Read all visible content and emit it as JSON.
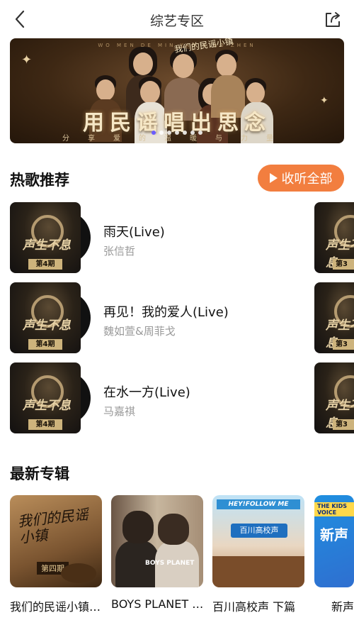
{
  "header": {
    "title": "综艺专区",
    "back_icon": "chevron-left-icon",
    "share_icon": "share-icon"
  },
  "banner": {
    "top_text": "WO MEN DE MIN YAO XIAO ZHEN",
    "logo_text": "我们的民谣小镇",
    "slogan": "用民谣唱出思念",
    "subtitle": "分享爱的温暖与力量",
    "dots_count": 7,
    "active_dot": 0
  },
  "hot_songs": {
    "section_title": "热歌推荐",
    "listen_all_label": "收听全部",
    "play_icon": "play-icon",
    "cover_episode": "第4期",
    "side_episode": "第3",
    "cover_logo": "声生不息",
    "items": [
      {
        "name": "雨天(Live)",
        "artist": "张信哲"
      },
      {
        "name": "再见！我的爱人(Live)",
        "artist": "魏如萱&周菲戈"
      },
      {
        "name": "在水一方(Live)",
        "artist": "马嘉祺"
      }
    ]
  },
  "new_albums": {
    "section_title": "最新专辑",
    "items": [
      {
        "title": "我们的民谣小镇…",
        "cover_text": "我们的民谣小镇",
        "cover_badge": "第四期"
      },
      {
        "title": "BOYS PLANET …",
        "cover_text": "BOYS PLANET"
      },
      {
        "title": "百川高校声 下篇",
        "cover_text": "百川高校声",
        "cover_header": "HEY!FOLLOW ME"
      },
      {
        "title": "新声",
        "cover_text": "新声",
        "cover_header": "THE KIDS VOICE"
      }
    ]
  },
  "colors": {
    "accent": "#f27e3f",
    "active_dot": "#6a5cff"
  }
}
